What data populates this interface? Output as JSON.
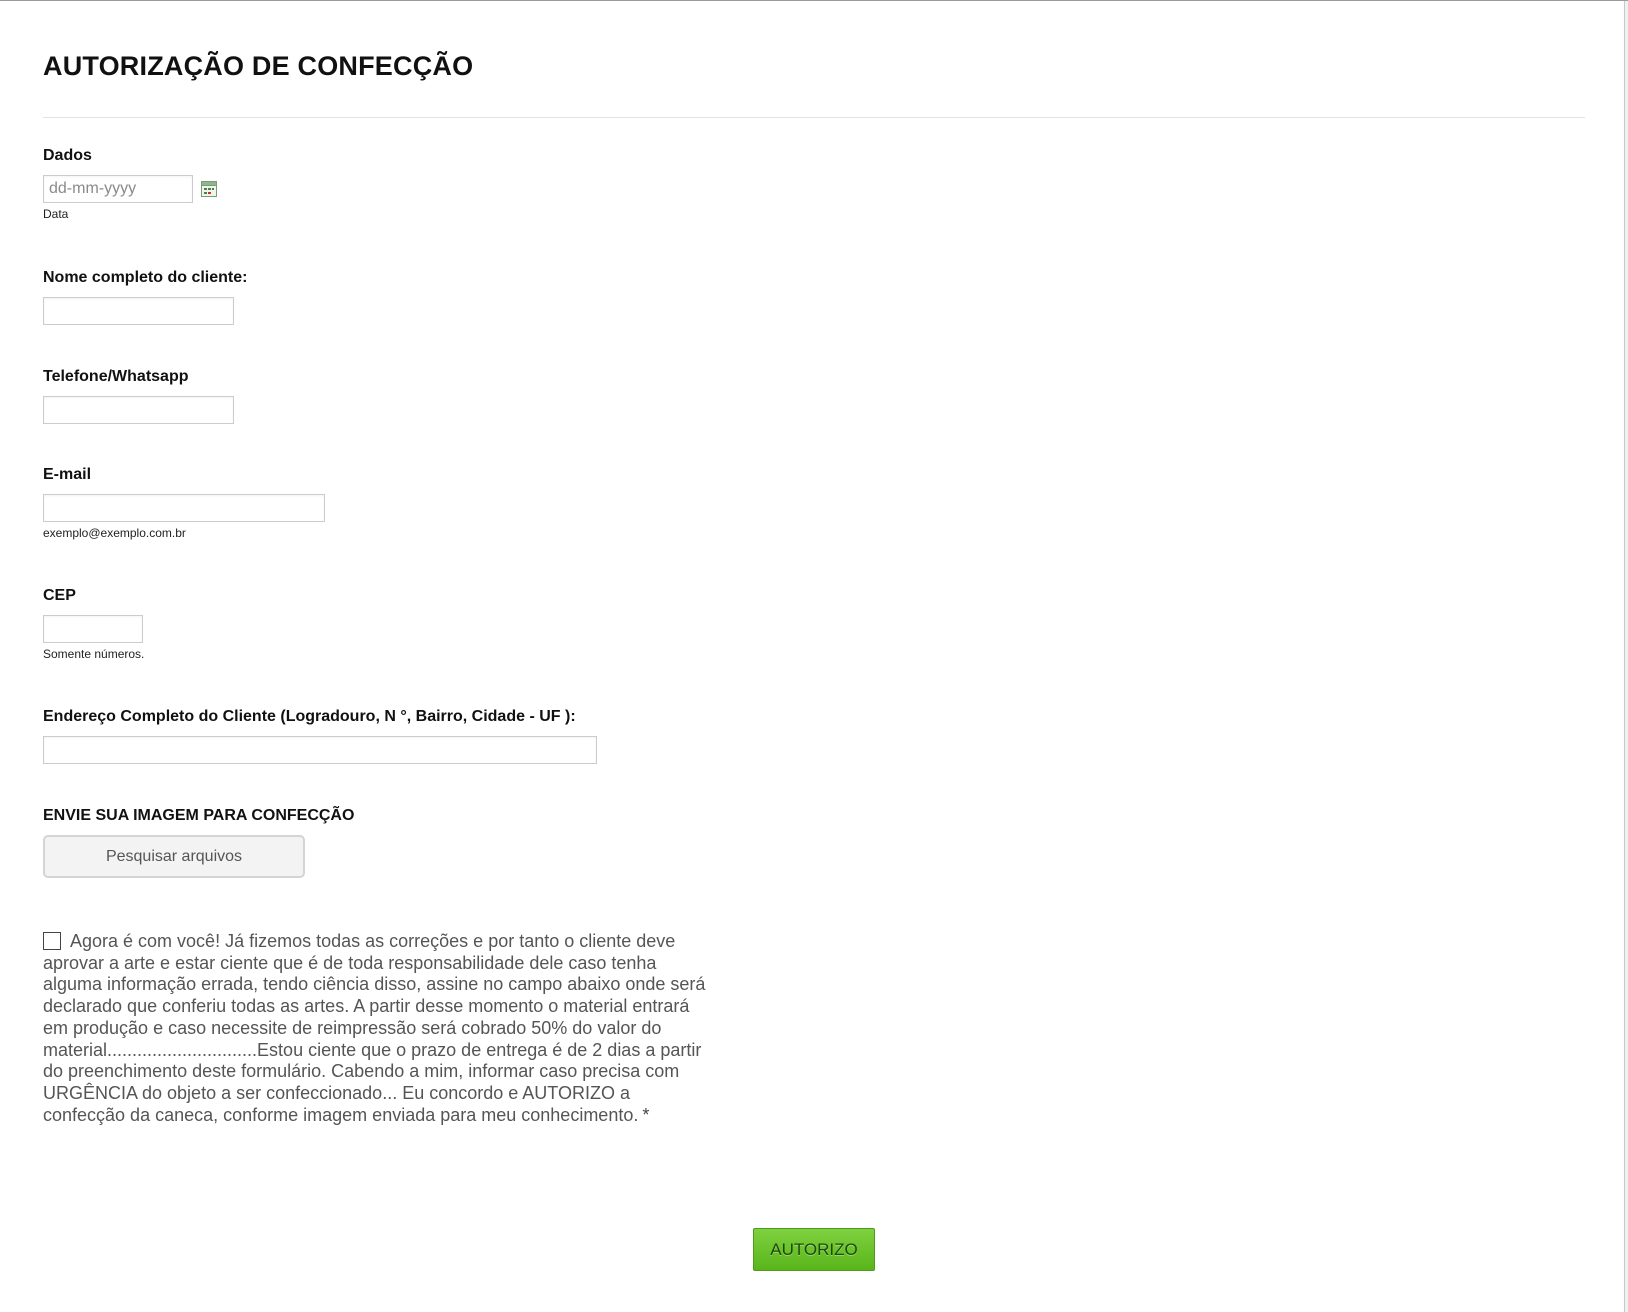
{
  "form": {
    "title": "AUTORIZAÇÃO DE CONFECÇÃO",
    "date": {
      "label": "Dados",
      "placeholder": "dd-mm-yyyy",
      "sublabel": "Data",
      "icon": "calendar-icon"
    },
    "name": {
      "label": "Nome completo do cliente:",
      "value": ""
    },
    "phone": {
      "label": "Telefone/Whatsapp",
      "value": ""
    },
    "email": {
      "label": "E-mail",
      "value": "",
      "sublabel": "exemplo@exemplo.com.br"
    },
    "cep": {
      "label": "CEP",
      "value": "",
      "sublabel": "Somente números."
    },
    "address": {
      "label": "Endereço Completo do Cliente (Logradouro, N °, Bairro, Cidade - UF ):",
      "value": ""
    },
    "upload": {
      "label": "ENVIE SUA IMAGEM PARA CONFECÇÃO",
      "button_label": "Pesquisar arquivos"
    },
    "consent": {
      "checked": false,
      "text": "Agora é com você! Já fizemos todas as correções e por tanto o cliente deve aprovar a arte e estar ciente que é de toda responsabilidade dele caso tenha alguma informação errada, tendo ciência disso, assine no campo abaixo onde será declarado que conferiu todas as artes. A partir desse momento o material entrará em produção e caso necessite de reimpressão será cobrado 50% do valor do material..............................Estou ciente que o prazo de entrega é de 2 dias a partir do preenchimento deste formulário. Cabendo a mim, informar caso precisa com URGÊNCIA do objeto a ser confeccionado... Eu concordo e AUTORIZO a confecção da caneca, conforme imagem enviada para meu conhecimento.",
      "required_mark": "*"
    },
    "submit_label": "AUTORIZO"
  },
  "colors": {
    "submit_green": "#6cc52c",
    "text_gray": "#555555",
    "border_gray": "#cccccc"
  }
}
